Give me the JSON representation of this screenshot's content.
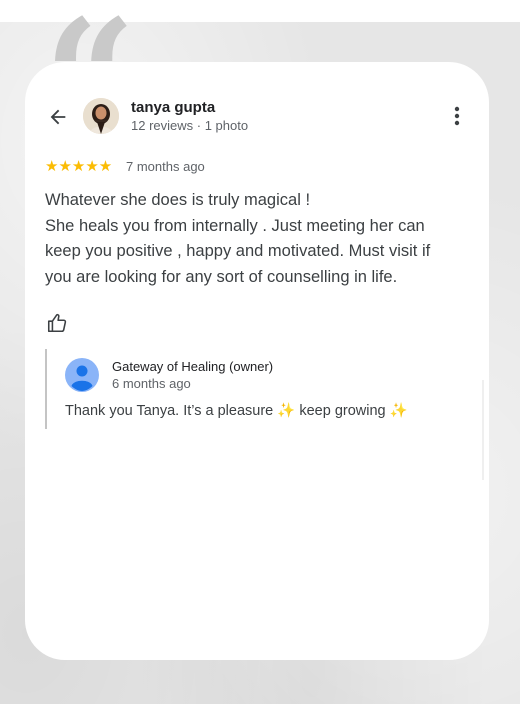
{
  "decoration": {
    "quote_mark": "“"
  },
  "review": {
    "author": "tanya gupta",
    "author_meta": "12 reviews · 1 photo",
    "rating": 5,
    "stars": "★★★★★",
    "time_ago": "7 months ago",
    "text_lines": [
      "Whatever she does is truly magical !",
      "She heals you from internally . Just meeting her can",
      "keep you positive , happy and motivated. Must visit if",
      "you are looking for any sort of counselling in life."
    ]
  },
  "owner_reply": {
    "name": "Gateway of Healing (owner)",
    "time_ago": "6 months ago",
    "text_start": "Thank you Tanya. It’s a pleasure ",
    "sparkle": "✨",
    "text_middle": " keep growing "
  },
  "colors": {
    "star": "#fbbc04",
    "owner_avatar": "#4285f4",
    "text_primary": "#202124",
    "text_secondary": "#5f6368"
  },
  "icons": [
    "back-arrow-icon",
    "more-vert-icon",
    "thumbs-up-icon",
    "person-icon"
  ]
}
